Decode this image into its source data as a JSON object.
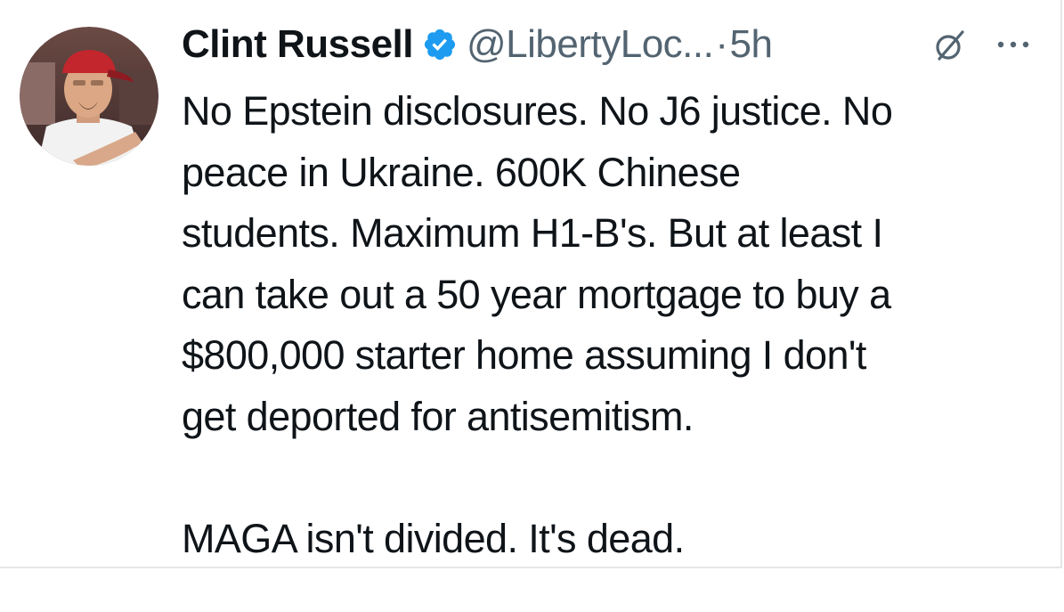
{
  "post": {
    "author_name": "Clint Russell",
    "handle": "@LibertyLoc...",
    "separator": "·",
    "time": "5h",
    "text_lines": [
      "No Epstein disclosures. No J6 justice. No",
      "peace in Ukraine. 600K Chinese",
      "students. Maximum H1-B's. But at least I",
      "can take out a 50 year mortgage to buy a",
      "$800,000 starter home assuming I don't",
      "get deported for antisemitism.",
      "MAGA isn't divided. It's dead."
    ]
  },
  "icons": {
    "verified": "verified-badge-icon",
    "grok": "grok-icon",
    "more": "more-options-icon"
  },
  "colors": {
    "verified_blue": "#1d9bf0",
    "text_primary": "#0f1419",
    "text_secondary": "#536471"
  }
}
